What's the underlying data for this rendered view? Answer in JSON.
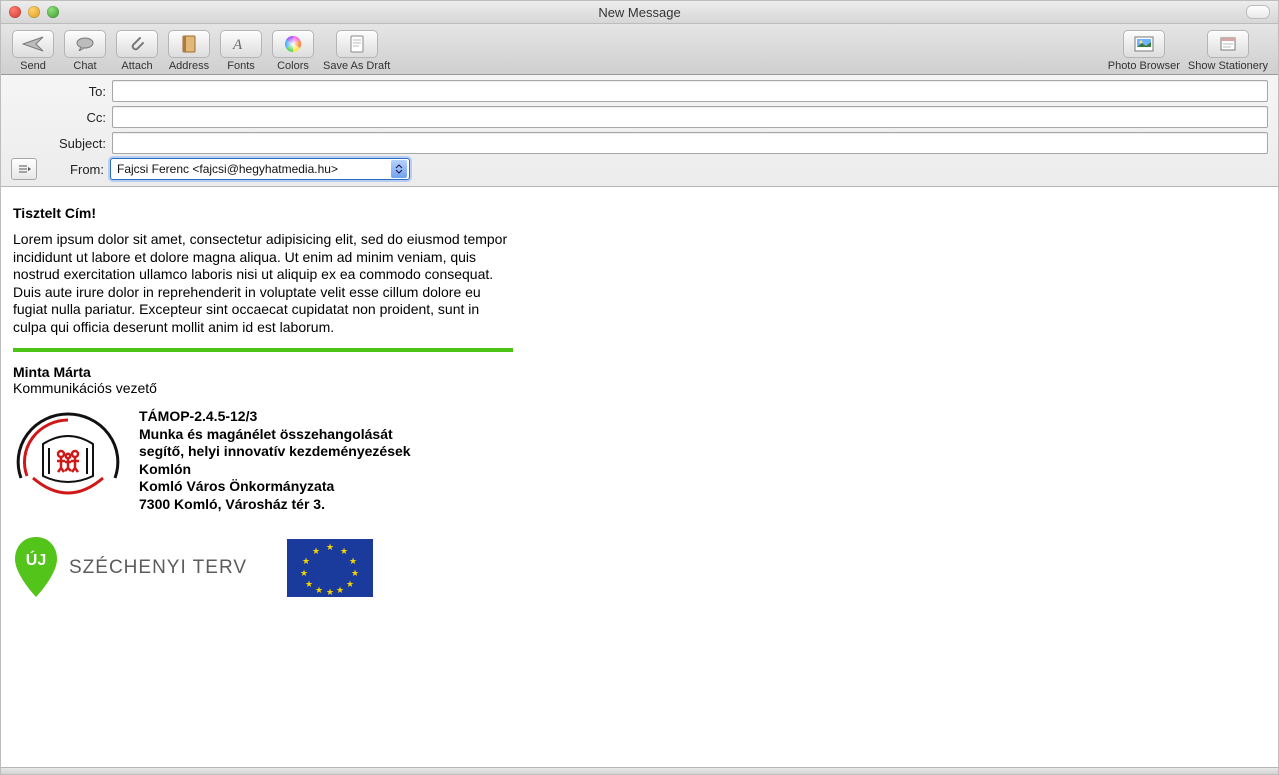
{
  "window": {
    "title": "New Message"
  },
  "toolbar": {
    "items": [
      {
        "key": "send",
        "label": "Send"
      },
      {
        "key": "chat",
        "label": "Chat"
      },
      {
        "key": "attach",
        "label": "Attach"
      },
      {
        "key": "address",
        "label": "Address"
      },
      {
        "key": "fonts",
        "label": "Fonts"
      },
      {
        "key": "colors",
        "label": "Colors"
      },
      {
        "key": "draft",
        "label": "Save As Draft"
      }
    ],
    "right": [
      {
        "key": "photo",
        "label": "Photo Browser"
      },
      {
        "key": "stationery",
        "label": "Show Stationery"
      }
    ]
  },
  "headers": {
    "to_label": "To:",
    "cc_label": "Cc:",
    "subject_label": "Subject:",
    "from_label": "From:",
    "to_value": "",
    "cc_value": "",
    "subject_value": "",
    "from_value": "Fajcsi Ferenc <fajcsi@hegyhatmedia.hu>"
  },
  "body": {
    "salutation": "Tisztelt Cím!",
    "paragraph": "Lorem ipsum dolor sit amet, consectetur adipisicing elit, sed do eiusmod tempor incididunt ut labore et dolore magna aliqua. Ut enim ad minim veniam, quis nostrud exercitation ullamco laboris nisi ut aliquip ex ea commodo consequat. Duis aute irure dolor in reprehenderit in voluptate velit esse cillum dolore eu fugiat nulla pariatur. Excepteur sint occaecat cupidatat non proident, sunt in culpa qui officia deserunt mollit anim id est laborum.",
    "signature": {
      "name": "Minta Márta",
      "role": "Kommunikációs vezető"
    },
    "project": {
      "code": "TÁMOP-2.4.5-12/3",
      "line1": "Munka és magánélet összehangolását",
      "line2": "segítő, helyi innovatív kezdeményezések",
      "line3": "Komlón",
      "org": "Komló Város Önkormányzata",
      "address": "7300 Komló, Városház tér 3."
    },
    "logos": {
      "uj": "ÚJ",
      "szechenyi": "SZÉCHENYI TERV"
    }
  }
}
